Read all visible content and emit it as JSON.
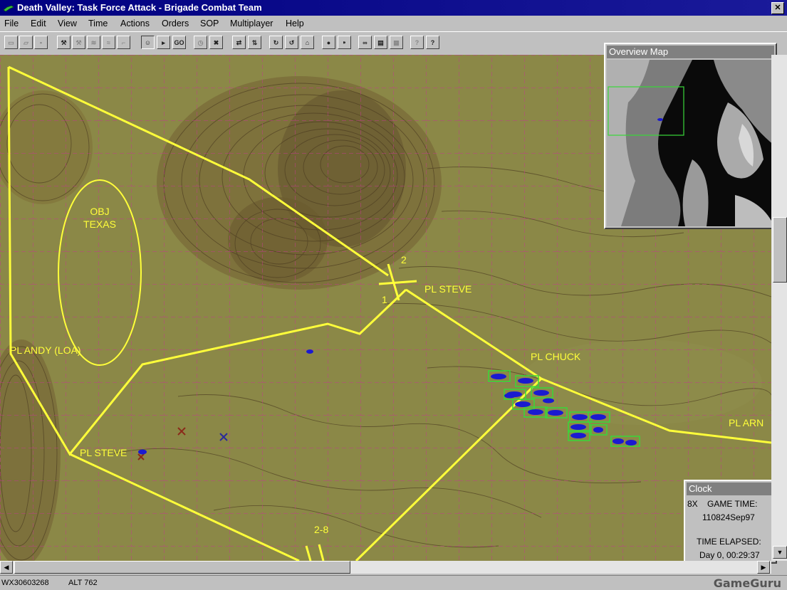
{
  "window": {
    "title": "Death Valley:  Task Force Attack - Brigade Combat Team",
    "close_glyph": "✕"
  },
  "menu": [
    "File",
    "Edit",
    "View",
    "Time",
    "Actions",
    "Orders",
    "SOP",
    "Multiplayer",
    "Help"
  ],
  "toolbar": {
    "go_label": "GO",
    "help_label": "?",
    "context_help_label": "?",
    "icons": [
      "new-icon",
      "open-icon",
      "save-icon",
      "tool-icon",
      "tool-icon",
      "tool-icon",
      "tool-icon",
      "tool-icon",
      "unit-icon",
      "pointer-icon",
      "go-icon",
      "clock-icon",
      "cancel-icon",
      "order-icon",
      "order-icon",
      "route-icon",
      "route-icon",
      "route-icon",
      "stop-icon",
      "fire-icon",
      "binoculars-icon",
      "report-icon",
      "report-icon",
      "help-icon",
      "context-help-icon"
    ]
  },
  "map": {
    "labels": {
      "obj_line1": "OBJ",
      "obj_line2": "TEXAS",
      "pl_andy": "PL ANDY (LOA)",
      "pl_steve_left": "PL STEVE",
      "pl_steve_right": "PL STEVE",
      "pl_chuck": "PL CHUCK",
      "pl_arn": "PL ARN",
      "boundary_2": "2",
      "boundary_1": "1",
      "boundary_28": "2-8"
    },
    "colors": {
      "terrain": "#8b8847",
      "control_lines": "#ffff3a",
      "grid": "#c03c8c",
      "friendly": "#1a1ad0",
      "selected": "#38d838"
    }
  },
  "overview": {
    "title": "Overview Map"
  },
  "clock": {
    "title": "Clock",
    "speed": "8X",
    "game_time_label": "GAME TIME:",
    "game_time_value": "110824Sep97",
    "elapsed_label": "TIME ELAPSED:",
    "elapsed_value": "Day 0, 00:29:37"
  },
  "status": {
    "grid_ref": "WX30603268",
    "altitude": "ALT 762"
  },
  "watermark": "GameGuru"
}
